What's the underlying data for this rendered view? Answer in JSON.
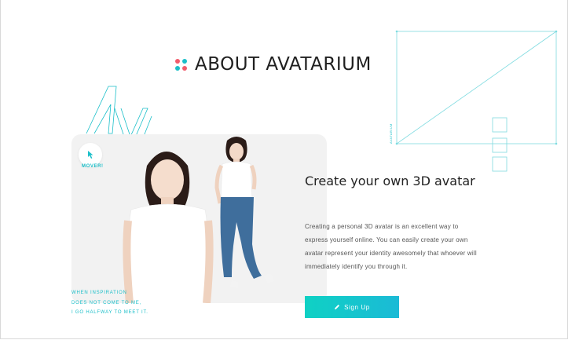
{
  "section": {
    "title": "ABOUT AVATARIUM",
    "dot_colors": [
      "#f25c6c",
      "#1bbfc9",
      "#1bbfc9",
      "#f25c6c"
    ]
  },
  "wireframe": {
    "side_label": "AVATARIUM",
    "accent_color": "#7fdbe0"
  },
  "card": {
    "mover_label": "MOVER!",
    "quote_lines": [
      "WHEN INSPIRATION",
      "DOES NOT COME TO ME,",
      "I GO HALFWAY TO MEET IT."
    ]
  },
  "content": {
    "heading": "Create your own 3D avatar",
    "description": "Creating a personal 3D avatar is an excellent way to express yourself online. You can easily create your own avatar represent your identity awesomely that whoever will immediately identify you through it.",
    "signup_label": "Sign Up",
    "signup_icon": "pencil-icon"
  },
  "colors": {
    "accent": "#1bbfc9",
    "accent_gradient_start": "#0fd1c4",
    "accent_gradient_end": "#1bbad6"
  }
}
